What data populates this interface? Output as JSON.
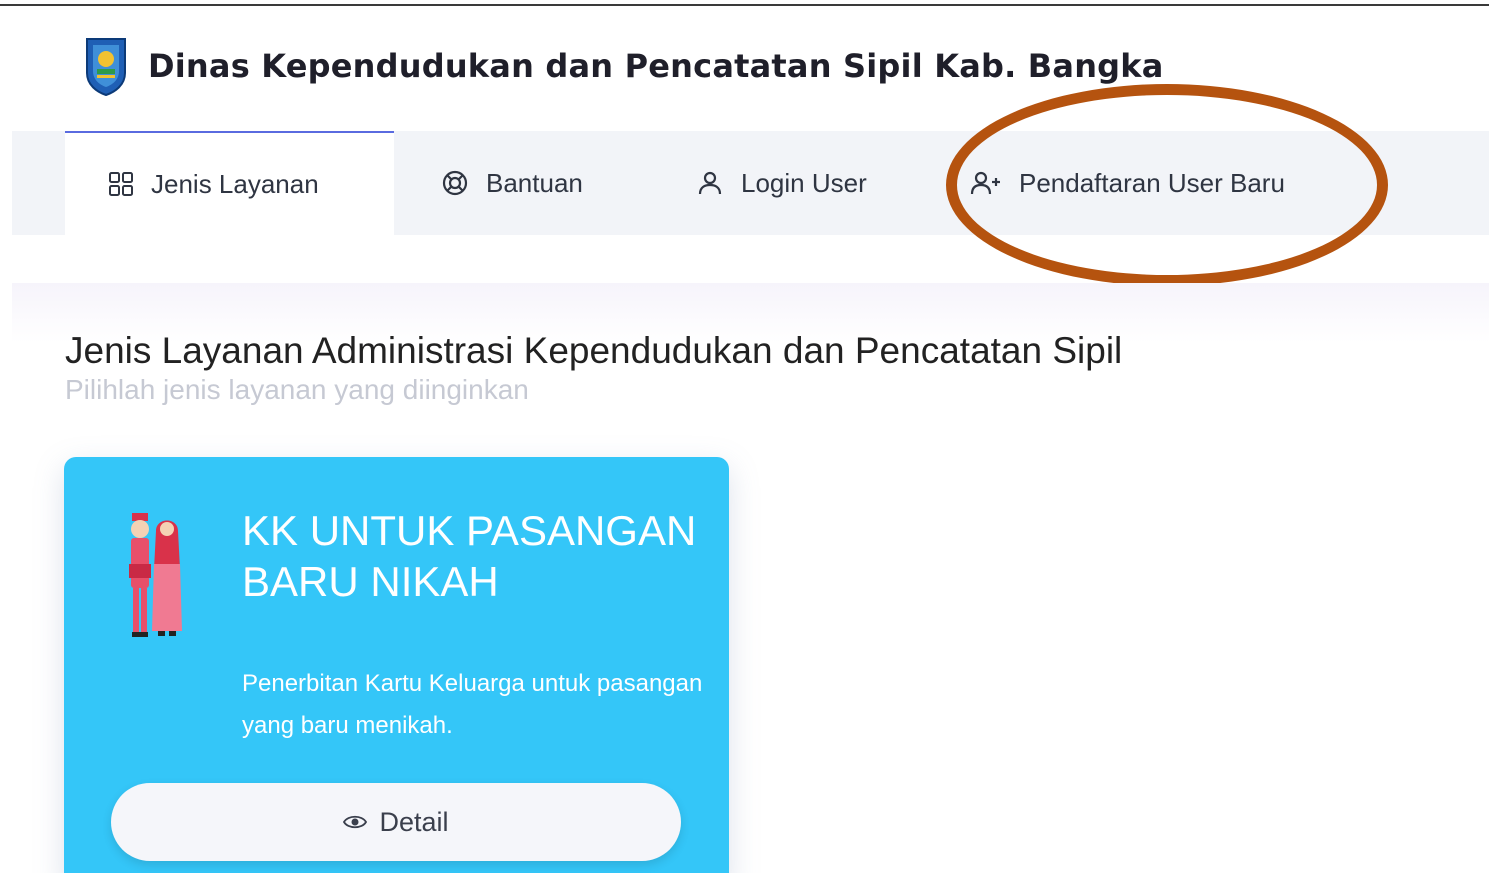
{
  "header": {
    "title": "Dinas Kependudukan dan Pencatatan Sipil Kab. Bangka",
    "logo_icon": "regency-shield-logo"
  },
  "nav": {
    "items": [
      {
        "label": "Jenis Layanan",
        "icon": "grid-icon",
        "active": true
      },
      {
        "label": "Bantuan",
        "icon": "lifebuoy-icon",
        "active": false
      },
      {
        "label": "Login User",
        "icon": "user-icon",
        "active": false
      },
      {
        "label": "Pendaftaran User Baru",
        "icon": "user-plus-icon",
        "active": false
      }
    ]
  },
  "annotation": {
    "shape": "ellipse",
    "color": "#b5530f",
    "target": "Pendaftaran User Baru"
  },
  "main": {
    "title": "Jenis Layanan Administrasi Kependudukan dan Pencatatan Sipil",
    "subtitle": "Pilihlah jenis layanan yang diinginkan"
  },
  "service_card": {
    "title": "KK UNTUK PASANGAN BARU NIKAH",
    "description": "Penerbitan Kartu Keluarga untuk pasangan yang baru menikah.",
    "button_label": "Detail",
    "button_icon": "eye-icon",
    "background": "#34c6f8"
  },
  "colors": {
    "accent": "#5a6be0",
    "nav_bg": "#f2f4f8",
    "card": "#34c6f8"
  }
}
